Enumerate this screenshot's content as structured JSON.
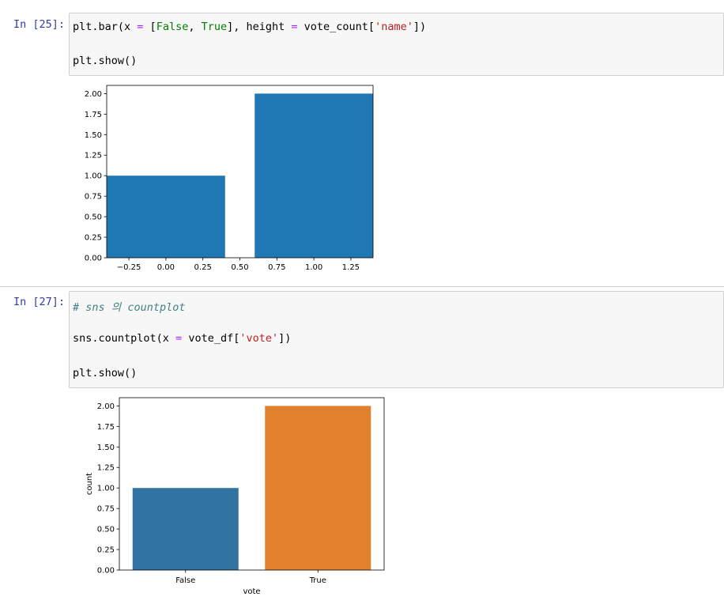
{
  "cells": [
    {
      "prompt": "In [25]:",
      "code": {
        "line1": {
          "a": "plt.bar(x ",
          "eq": "=",
          "b": " [",
          "f": "False",
          "c": ", ",
          "t": "True",
          "d": "], height ",
          "eq2": "=",
          "e": " vote_count[",
          "s": "'name'",
          "g": "])"
        },
        "line2": "plt.show()"
      }
    },
    {
      "prompt": "In [27]:",
      "code": {
        "comment": "# sns 의 countplot",
        "line2": {
          "a": "sns.countplot(x ",
          "eq": "=",
          "b": " vote_df[",
          "s": "'vote'",
          "c": "])"
        },
        "line3": "plt.show()"
      }
    }
  ],
  "chart_data": [
    {
      "type": "bar",
      "x": [
        0,
        1
      ],
      "values": [
        1,
        2
      ],
      "xlim": [
        -0.4,
        1.4
      ],
      "ylim": [
        0,
        2.1
      ],
      "xticks": [
        "−0.25",
        "0.00",
        "0.25",
        "0.50",
        "0.75",
        "1.00",
        "1.25"
      ],
      "xtick_values": [
        -0.25,
        0,
        0.25,
        0.5,
        0.75,
        1.0,
        1.25
      ],
      "yticks": [
        "0.00",
        "0.25",
        "0.50",
        "0.75",
        "1.00",
        "1.25",
        "1.50",
        "1.75",
        "2.00"
      ],
      "ytick_values": [
        0,
        0.25,
        0.5,
        0.75,
        1.0,
        1.25,
        1.5,
        1.75,
        2.0
      ],
      "colors": [
        "#1f77b4",
        "#1f77b4"
      ],
      "xlabel": "",
      "ylabel": ""
    },
    {
      "type": "bar",
      "categories": [
        "False",
        "True"
      ],
      "values": [
        1,
        2
      ],
      "ylim": [
        0,
        2.1
      ],
      "yticks": [
        "0.00",
        "0.25",
        "0.50",
        "0.75",
        "1.00",
        "1.25",
        "1.50",
        "1.75",
        "2.00"
      ],
      "ytick_values": [
        0,
        0.25,
        0.5,
        0.75,
        1.0,
        1.25,
        1.5,
        1.75,
        2.0
      ],
      "colors": [
        "#3274a1",
        "#e1812c"
      ],
      "xlabel": "vote",
      "ylabel": "count"
    }
  ]
}
